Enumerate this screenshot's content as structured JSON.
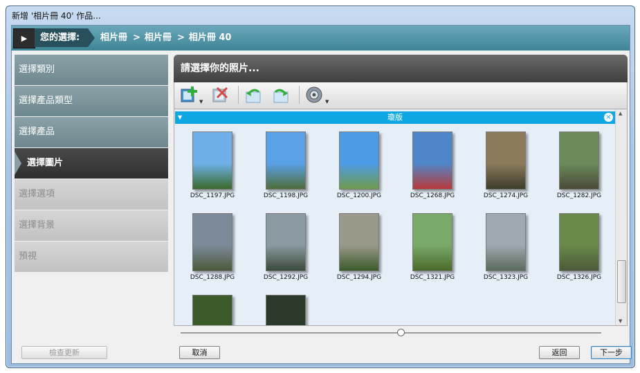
{
  "window": {
    "title": "新增 '相片冊 40' 作品..."
  },
  "breadcrumb": {
    "selection_label": "您的選擇:",
    "separator": ">",
    "items": [
      "相片冊",
      "相片冊",
      "相片冊 40"
    ]
  },
  "sidebar": {
    "items": [
      {
        "label": "選擇類別",
        "state": "done"
      },
      {
        "label": "選擇產品類型",
        "state": "done"
      },
      {
        "label": "選擇產品",
        "state": "done"
      },
      {
        "label": "選擇圖片",
        "state": "current"
      },
      {
        "label": "選擇選項",
        "state": "todo"
      },
      {
        "label": "選擇背景",
        "state": "todo"
      },
      {
        "label": "預視",
        "state": "todo"
      }
    ]
  },
  "main": {
    "title": "請選擇你的照片...",
    "toolbar": {
      "icons": [
        "add-photos-icon",
        "remove-photos-icon",
        "rotate-left-icon",
        "rotate-right-icon",
        "settings-gear-icon"
      ]
    },
    "group": {
      "name": "瓊版",
      "close": "×"
    },
    "photos": [
      {
        "label": "DSC_1197.JPG",
        "colors": [
          "#6fb0e8",
          "#3a6a2a"
        ]
      },
      {
        "label": "DSC_1198.JPG",
        "colors": [
          "#5aa0e6",
          "#4f6e3a"
        ]
      },
      {
        "label": "DSC_1200.JPG",
        "colors": [
          "#4c9be6",
          "#6e9b4a"
        ]
      },
      {
        "label": "DSC_1268.JPG",
        "colors": [
          "#4f86c9",
          "#b83a3a"
        ]
      },
      {
        "label": "DSC_1274.JPG",
        "colors": [
          "#8a7a5a",
          "#3d3d2d"
        ]
      },
      {
        "label": "DSC_1282.JPG",
        "colors": [
          "#6a8a5a",
          "#4a4a3a"
        ]
      },
      {
        "label": "DSC_1288.JPG",
        "colors": [
          "#7c8a9a",
          "#4a5a3a"
        ]
      },
      {
        "label": "DSC_1292.JPG",
        "colors": [
          "#8a9aa0",
          "#3a4a3a"
        ]
      },
      {
        "label": "DSC_1294.JPG",
        "colors": [
          "#9a9a8a",
          "#3a5a2a"
        ]
      },
      {
        "label": "DSC_1321.JPG",
        "colors": [
          "#7aaa6a",
          "#4a6a2a"
        ]
      },
      {
        "label": "DSC_1323.JPG",
        "colors": [
          "#a0a8b0",
          "#5a6a5a"
        ]
      },
      {
        "label": "DSC_1326.JPG",
        "colors": [
          "#6a8a4a",
          "#4a5a3a"
        ]
      },
      {
        "label": "",
        "colors": [
          "#3a5a2a",
          "#2a3a1a"
        ]
      },
      {
        "label": "",
        "colors": [
          "#2a3a2a",
          "#1a2a1a"
        ]
      }
    ]
  },
  "buttons": {
    "check_updates": "檢查更新",
    "cancel": "取消",
    "back": "返回",
    "next": "下一步"
  }
}
